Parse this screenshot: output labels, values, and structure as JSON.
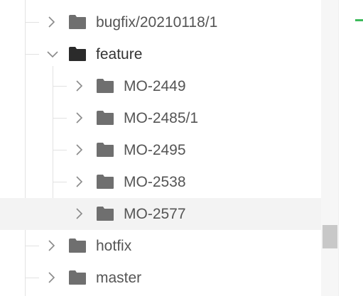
{
  "branch_tree": {
    "items": [
      {
        "label": "bugfix/20210118/1",
        "expanded": false
      },
      {
        "label": "feature",
        "expanded": true
      },
      {
        "label": "MO-2449",
        "expanded": false
      },
      {
        "label": "MO-2485/1",
        "expanded": false
      },
      {
        "label": "MO-2495",
        "expanded": false
      },
      {
        "label": "MO-2538",
        "expanded": false
      },
      {
        "label": "MO-2577",
        "expanded": false,
        "selected": true
      },
      {
        "label": "hotfix",
        "expanded": false
      },
      {
        "label": "master",
        "expanded": false
      }
    ]
  },
  "icons": {
    "folder": "folder-icon",
    "collapsed": "chevron-right-icon",
    "expanded": "chevron-down-icon"
  },
  "colors": {
    "folder_collapsed": "#6f6f6f",
    "folder_expanded": "#2b2b2b",
    "selection_background": "#f3f3f3",
    "status_marker": "#3dbb5b"
  }
}
